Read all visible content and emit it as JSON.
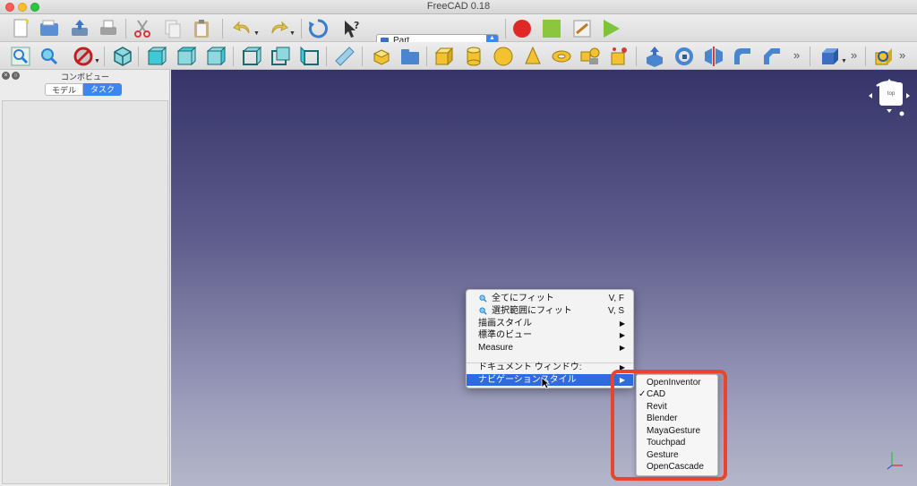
{
  "window": {
    "title": "FreeCAD 0.18"
  },
  "toolbar1": {
    "icons": [
      "new-file-icon",
      "open-file-icon",
      "save-icon",
      "print-icon",
      "cut-icon",
      "copy-icon",
      "paste-icon",
      "undo-icon",
      "redo-icon",
      "refresh-icon",
      "whats-this-icon"
    ],
    "workbench": "Part",
    "macro_icons": [
      "record-macro-icon",
      "stop-macro-icon",
      "edit-macro-icon",
      "run-macro-icon"
    ]
  },
  "toolbar2": {
    "icons": [
      "fit-all-icon",
      "fit-selection-icon",
      "draw-style-icon",
      "isometric-view-icon",
      "front-view-icon",
      "top-view-icon",
      "right-view-icon",
      "rear-view-icon",
      "bottom-view-icon",
      "left-view-icon",
      "measure-icon",
      "part-icon",
      "group-icon",
      "box-icon",
      "cylinder-icon",
      "sphere-icon",
      "cone-icon",
      "torus-icon",
      "primitives-icon",
      "shape-builder-icon",
      "extrude-icon",
      "revolve-icon",
      "mirror-icon",
      "fillet-icon",
      "chamfer-icon",
      "boolean-icon",
      "check-geometry-icon"
    ],
    "more": "»"
  },
  "combo_view": {
    "title": "コンボビュー",
    "tabs": {
      "model": "モデル",
      "task": "タスク"
    }
  },
  "nav_cube": {
    "face": "top"
  },
  "context_menu": {
    "items": [
      {
        "label": "全てにフィット",
        "shortcut": "V, F",
        "icon": "fit-all-icon"
      },
      {
        "label": "選択範囲にフィット",
        "shortcut": "V, S",
        "icon": "fit-selection-icon"
      },
      {
        "label": "描画スタイル",
        "submenu": "▶"
      },
      {
        "label": "標準のビュー",
        "submenu": "▶"
      },
      {
        "label": "Measure",
        "submenu": "▶"
      },
      {
        "label": "ドキュメント ウィンドウ:",
        "submenu": "▶"
      },
      {
        "label": "ナビゲーションスタイル",
        "submenu": "▶"
      }
    ]
  },
  "nav_style_submenu": {
    "items": [
      "OpenInventor",
      "CAD",
      "Revit",
      "Blender",
      "MayaGesture",
      "Touchpad",
      "Gesture",
      "OpenCascade"
    ],
    "checked": "✓"
  },
  "colors": {
    "accent": "#2f6be0",
    "highlight_box": "#e8452c",
    "viewport_top": "#35346a",
    "viewport_bottom": "#b4b6c9"
  }
}
